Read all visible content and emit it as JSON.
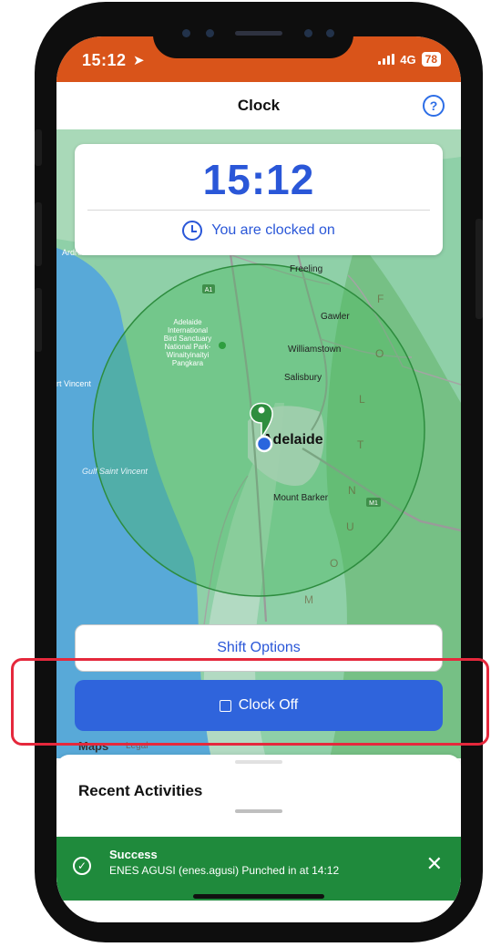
{
  "status_bar": {
    "time": "15:12",
    "network": "4G",
    "battery": "78"
  },
  "header": {
    "title": "Clock",
    "help_glyph": "?"
  },
  "clock_card": {
    "time": "15:12",
    "status": "You are clocked on"
  },
  "map": {
    "labels": {
      "adelaide": "Adelaide",
      "freeling": "Freeling",
      "gawler": "Gawler",
      "williamstown": "Williamstown",
      "salisbury": "Salisbury",
      "mount_barker": "Mount Barker",
      "port_vincent": "rt Vincent",
      "ardrossan": "Ardrossan",
      "gulf": "Gulf Saint Vincent",
      "sanctuary_1": "Adelaide",
      "sanctuary_2": "International",
      "sanctuary_3": "Bird Sanctuary",
      "sanctuary_4": "National Park-",
      "sanctuary_5": "Winaityinaityi",
      "sanctuary_6": "Pangkara",
      "range": "MOUNT LOFTY",
      "route_a1": "A1",
      "route_m1": "M1"
    },
    "attribution": "Maps",
    "legal": "Legal"
  },
  "buttons": {
    "shift_options": "Shift Options",
    "clock_off": "Clock Off"
  },
  "sheet": {
    "recent_title": "Recent Activities"
  },
  "toast": {
    "title": "Success",
    "message": "ENES AGUSI (enes.agusi) Punched in at 14:12",
    "close_glyph": "✕"
  },
  "colors": {
    "status_bar": "#d9541a",
    "accent_blue": "#2a57d8",
    "button_blue": "#2f64dc",
    "toast_green": "#1f8a3c",
    "highlight_red": "#e5283c"
  }
}
